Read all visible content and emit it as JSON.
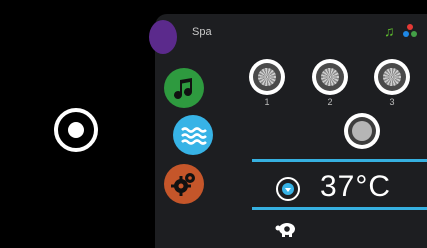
{
  "home_button": {
    "icon": "target-icon"
  },
  "panel": {
    "title": "Spa",
    "temperature": "37°C",
    "status_icons": {
      "music": "music-note-icon",
      "colors": "color-dots-icon"
    },
    "jets": [
      {
        "label": "1"
      },
      {
        "label": "2"
      },
      {
        "label": "3"
      }
    ],
    "sidebar": [
      "music-icon",
      "waves-icon",
      "gears-icon"
    ],
    "accent": "#37b3e6"
  }
}
